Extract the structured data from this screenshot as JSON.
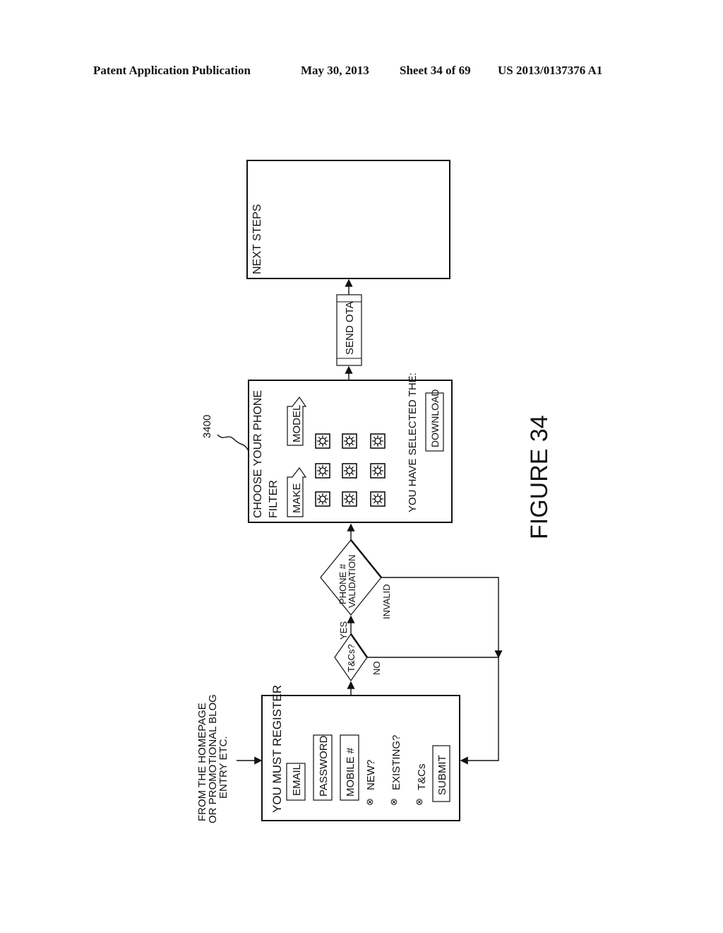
{
  "header": {
    "publication": "Patent Application Publication",
    "date": "May 30, 2013",
    "sheet": "Sheet 34 of 69",
    "patent_number": "US 2013/0137376 A1"
  },
  "figure": {
    "label": "FIGURE 34",
    "reference_numeral": "3400",
    "orientation": "rotated 90° counter-clockwise"
  },
  "entry_note": {
    "lines": [
      "FROM THE HOMEPAGE",
      "OR PROMOTIONAL BLOG",
      "ENTRY ETC."
    ]
  },
  "register_screen": {
    "title": "YOU MUST REGISTER",
    "fields": [
      "EMAIL",
      "PASSWORD",
      "MOBILE #"
    ],
    "options": [
      "NEW?",
      "EXISTING?",
      "T&Cs"
    ],
    "option_symbol": "⊗",
    "submit_label": "SUBMIT"
  },
  "decisions": {
    "tcs": {
      "label": "T&Cs?",
      "yes": "YES",
      "no": "NO"
    },
    "phone_validation": {
      "lines": [
        "PHONE #",
        "VALIDATION"
      ],
      "invalid": "INVALID"
    }
  },
  "choose_phone_screen": {
    "title": "CHOOSE YOUR PHONE",
    "filter_label": "FILTER",
    "make_label": "MAKE",
    "model_label": "MODEL",
    "phone_grid": {
      "rows": 3,
      "cols": 3,
      "icon": "gear-phone-icon"
    },
    "selected_text": "YOU HAVE SELECTED THE:",
    "download_label": "DOWNLOAD"
  },
  "send_ota": {
    "label": "SEND OTA"
  },
  "next_steps_screen": {
    "title": "NEXT STEPS"
  }
}
